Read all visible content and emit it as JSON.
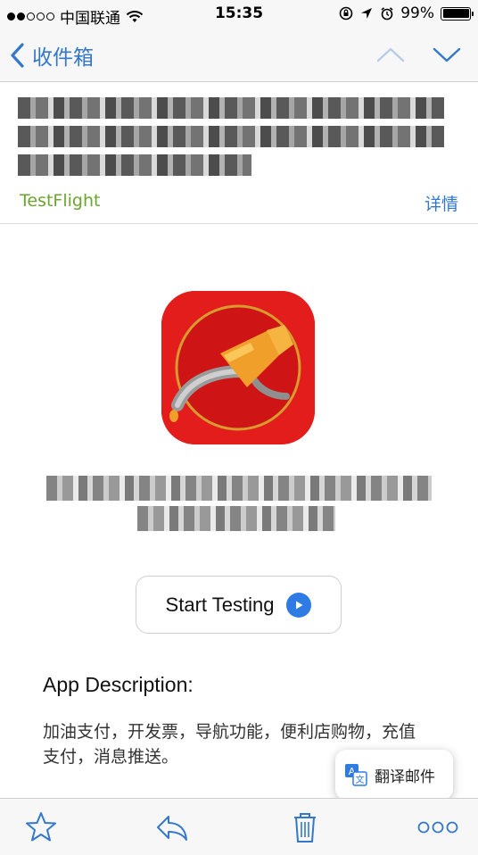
{
  "status_bar": {
    "carrier": "中国联通",
    "time": "15:35",
    "battery_percent": "99%"
  },
  "nav": {
    "back_label": "收件箱"
  },
  "email_header": {
    "sender": "TestFlight",
    "details_label": "详情"
  },
  "app": {
    "start_button_label": "Start Testing",
    "description_title": "App Description:",
    "description_text": "加油支付，开发票，导航功能，便利店购物，充值支付，消息推送。"
  },
  "translate": {
    "label": "翻译邮件"
  },
  "colors": {
    "accent": "#3478cb",
    "sender": "#6aa52f",
    "icon_background": "#e31c1c",
    "play_button": "#2f7be5"
  },
  "icons": [
    "signal-dots",
    "wifi-icon",
    "rotation-lock-icon",
    "location-icon",
    "alarm-icon",
    "battery-icon",
    "chevron-left-icon",
    "chevron-up-icon",
    "chevron-down-icon",
    "play-icon",
    "translate-icon",
    "star-icon",
    "reply-icon",
    "trash-icon",
    "more-icon"
  ]
}
